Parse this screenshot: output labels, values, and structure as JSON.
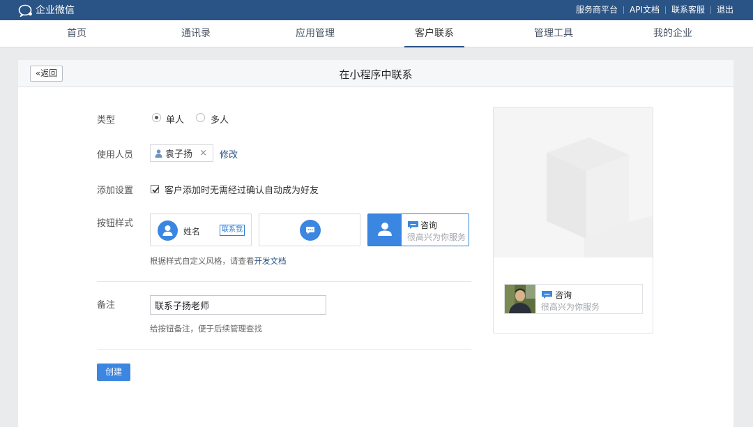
{
  "app": {
    "title": "企业微信"
  },
  "top_links": [
    "服务商平台",
    "API文档",
    "联系客服",
    "退出"
  ],
  "nav": {
    "items": [
      {
        "label": "首页"
      },
      {
        "label": "通讯录"
      },
      {
        "label": "应用管理"
      },
      {
        "label": "客户联系",
        "active": true
      },
      {
        "label": "管理工具"
      },
      {
        "label": "我的企业"
      }
    ]
  },
  "page": {
    "back_label": "返回",
    "title": "在小程序中联系"
  },
  "form": {
    "type": {
      "label": "类型",
      "options": [
        "单人",
        "多人"
      ],
      "selected": "单人"
    },
    "users": {
      "label": "使用人员",
      "user_name": "袁子扬",
      "remove": "×",
      "edit_link": "修改"
    },
    "add_settings": {
      "label": "添加设置",
      "checkbox_label": "客户添加时无需经过确认自动成为好友",
      "checked": true
    },
    "button_style": {
      "label": "按钮样式",
      "style1": {
        "name": "姓名",
        "button": "联系我"
      },
      "style3": {
        "title": "咨询",
        "subtitle": "很高兴为你服务"
      },
      "selected": 3,
      "hint_prefix": "根据样式自定义风格，请查看",
      "hint_link": "开发文档"
    },
    "note": {
      "label": "备注",
      "value": "联系子扬老师",
      "hint": "给按钮备注，便于后续管理查找"
    },
    "create_label": "创建"
  },
  "preview": {
    "title": "咨询",
    "subtitle": "很高兴为你服务"
  },
  "colors": {
    "topbar": "#2a5485",
    "accent": "#3b86e0",
    "link": "#2a5485"
  }
}
